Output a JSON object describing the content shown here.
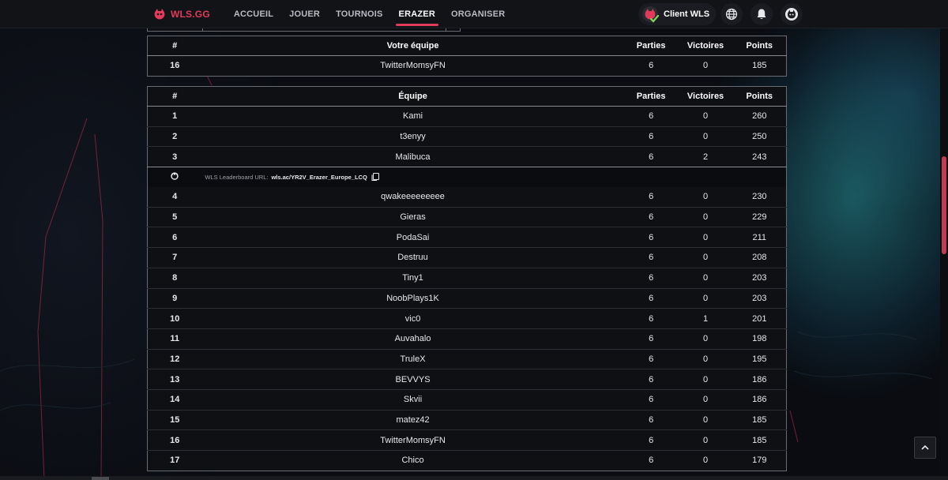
{
  "brand": {
    "name": "WLS.GG",
    "accent": "#e23a5a"
  },
  "nav": {
    "links": [
      {
        "label": "ACCUEIL",
        "active": false
      },
      {
        "label": "JOUER",
        "active": false
      },
      {
        "label": "TOURNOIS",
        "active": false
      },
      {
        "label": "ERAZER",
        "active": true
      },
      {
        "label": "ORGANISER",
        "active": false
      }
    ],
    "client_label": "Client WLS",
    "icons": [
      "globe-icon",
      "bell-icon",
      "profile-icon"
    ]
  },
  "your_team": {
    "headers": {
      "rank": "#",
      "team": "Votre équipe",
      "played": "Parties",
      "wins": "Victoires",
      "points": "Points"
    },
    "row": {
      "rank": "16",
      "team": "TwitterMomsyFN",
      "played": "6",
      "wins": "0",
      "points": "185"
    }
  },
  "leaderboard": {
    "headers": {
      "rank": "#",
      "team": "Équipe",
      "played": "Parties",
      "wins": "Victoires",
      "points": "Points"
    },
    "url_label": "WLS Leaderboard URL:",
    "url_value": "wls.ac/YR2V_Erazer_Europe_LCQ",
    "top_rows": [
      {
        "rank": "1",
        "team": "Kami",
        "played": "6",
        "wins": "0",
        "points": "260"
      },
      {
        "rank": "2",
        "team": "t3enyy",
        "played": "6",
        "wins": "0",
        "points": "250"
      },
      {
        "rank": "3",
        "team": "Malibuca",
        "played": "6",
        "wins": "2",
        "points": "243"
      }
    ],
    "rows": [
      {
        "rank": "4",
        "team": "qwakeeeeeeeee",
        "played": "6",
        "wins": "0",
        "points": "230"
      },
      {
        "rank": "5",
        "team": "Gieras",
        "played": "6",
        "wins": "0",
        "points": "229"
      },
      {
        "rank": "6",
        "team": "PodaSai",
        "played": "6",
        "wins": "0",
        "points": "211"
      },
      {
        "rank": "7",
        "team": "Destruu",
        "played": "6",
        "wins": "0",
        "points": "208"
      },
      {
        "rank": "8",
        "team": "Tiny1",
        "played": "6",
        "wins": "0",
        "points": "203"
      },
      {
        "rank": "9",
        "team": "NoobPlays1K",
        "played": "6",
        "wins": "0",
        "points": "203"
      },
      {
        "rank": "10",
        "team": "vic0",
        "played": "6",
        "wins": "1",
        "points": "201"
      },
      {
        "rank": "11",
        "team": "Auvahalo",
        "played": "6",
        "wins": "0",
        "points": "198"
      },
      {
        "rank": "12",
        "team": "TruleX",
        "played": "6",
        "wins": "0",
        "points": "195"
      },
      {
        "rank": "13",
        "team": "BEVVYS",
        "played": "6",
        "wins": "0",
        "points": "186"
      },
      {
        "rank": "14",
        "team": "Skvii",
        "played": "6",
        "wins": "0",
        "points": "186"
      },
      {
        "rank": "15",
        "team": "matez42",
        "played": "6",
        "wins": "0",
        "points": "185"
      },
      {
        "rank": "16",
        "team": "TwitterMomsyFN",
        "played": "6",
        "wins": "0",
        "points": "185"
      },
      {
        "rank": "17",
        "team": "Chico",
        "played": "6",
        "wins": "0",
        "points": "179"
      }
    ]
  }
}
